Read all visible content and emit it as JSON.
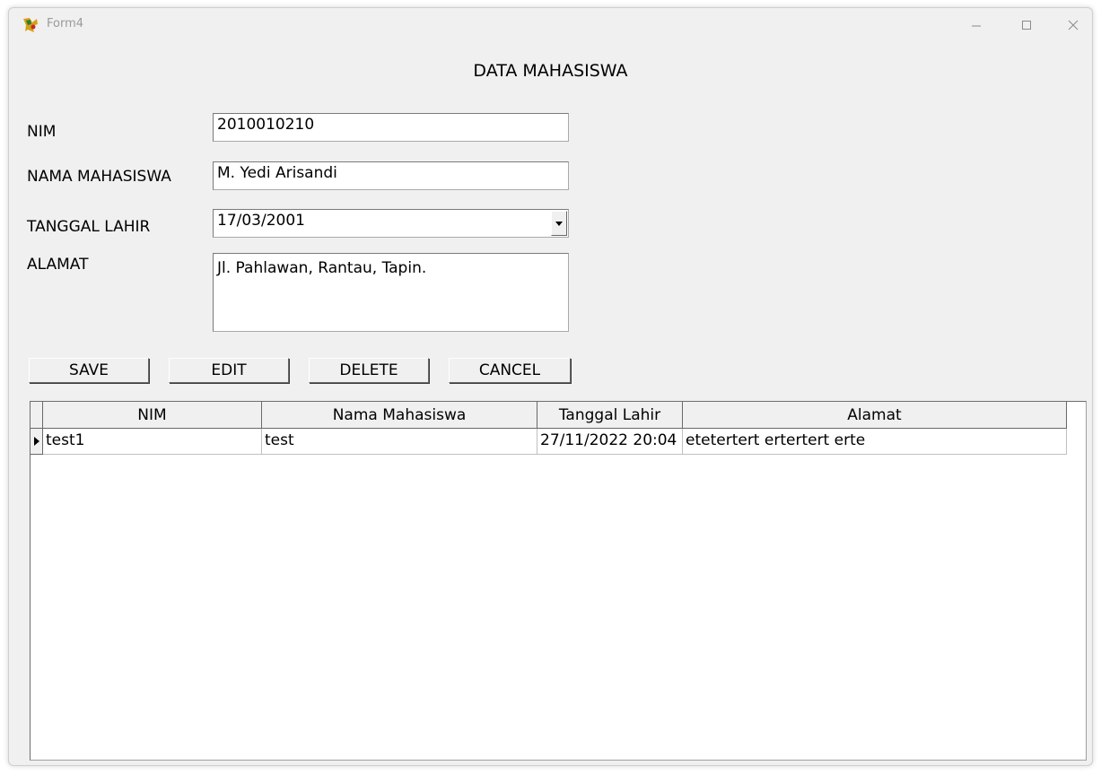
{
  "window": {
    "title": "Form4",
    "minimize_icon": "minimize-icon",
    "maximize_icon": "maximize-icon",
    "close_icon": "close-icon"
  },
  "heading": "DATA MAHASISWA",
  "form": {
    "nim_label": "NIM",
    "nim_value": "2010010210",
    "nama_label": "NAMA MAHASISWA",
    "nama_value": "M. Yedi Arisandi",
    "tanggal_label": "TANGGAL LAHIR",
    "tanggal_value": "17/03/2001",
    "alamat_label": "ALAMAT",
    "alamat_value": "Jl. Pahlawan, Rantau, Tapin."
  },
  "buttons": {
    "save": "SAVE",
    "edit": "EDIT",
    "delete": "DELETE",
    "cancel": "CANCEL"
  },
  "grid": {
    "columns": [
      "NIM",
      "Nama Mahasiswa",
      "Tanggal Lahir",
      "Alamat"
    ],
    "rows": [
      [
        "test1",
        "test",
        "27/11/2022 20:04",
        "etetertert ertertert erte"
      ]
    ]
  }
}
